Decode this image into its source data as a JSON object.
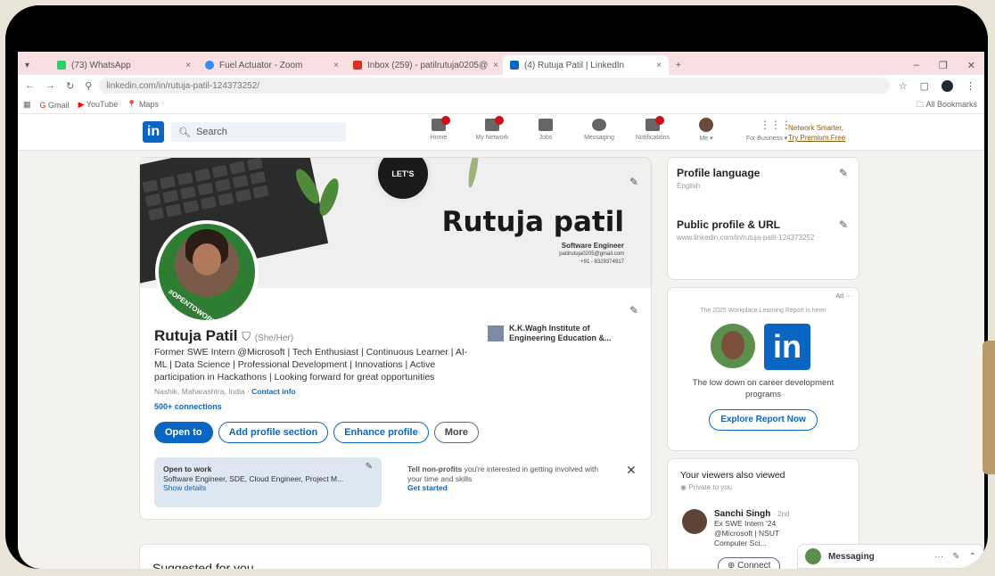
{
  "browser": {
    "tabs": [
      {
        "label": "(73) WhatsApp",
        "color": "#25d366"
      },
      {
        "label": "Fuel Actuator - Zoom",
        "color": "#2d8cff"
      },
      {
        "label": "Inbox (259) - patilrutuja0205@",
        "color": "#d93025"
      },
      {
        "label": "(4) Rutuja Patil | LinkedIn",
        "color": "#0a66c2",
        "active": true
      }
    ],
    "new_tab": "+",
    "url": "linkedin.com/in/rutuja-patil-124373252/",
    "bookmarks": [
      "Gmail",
      "YouTube",
      "Maps"
    ],
    "all_bookmarks": "All Bookmarks"
  },
  "linkedin": {
    "logo": "in",
    "search_placeholder": "Search",
    "nav": [
      {
        "label": "Home",
        "badge": true
      },
      {
        "label": "My Network",
        "badge": true
      },
      {
        "label": "Jobs",
        "badge": false
      },
      {
        "label": "Messaging",
        "badge": false
      },
      {
        "label": "Notifications",
        "badge": true
      },
      {
        "label": "Me ▾",
        "badge": false,
        "avatar": true
      },
      {
        "label": "For Business ▾",
        "badge": false
      }
    ],
    "premium": [
      "Network Smarter,",
      "Try Premium Free"
    ]
  },
  "profile": {
    "banner": {
      "cup_text": "LET'S",
      "name": "Rutuja patil",
      "title": "Software Engineer",
      "email": "patilrutuja0205@gmail.com",
      "phone": "+91 - 8329374917"
    },
    "avatar_text": "#OPENTOWORK",
    "name": "Rutuja Patil",
    "pronouns": "(She/Her)",
    "headline": "Former SWE Intern @Microsoft | Tech Enthusiast | Continuous Learner | AI-ML | Data Science | Professional Development | Innovations | Active participation in Hackathons | Looking forward for great opportunities",
    "location": "Nashik, Maharashtra, India",
    "contact_info": "Contact info",
    "connections": "500+ connections",
    "education": "K.K.Wagh Institute of Engineering Education &...",
    "buttons": {
      "open_to": "Open to",
      "add_section": "Add profile section",
      "enhance": "Enhance profile",
      "more": "More"
    },
    "open_to_work": {
      "title": "Open to work",
      "roles": "Software Engineer, SDE, Cloud Engineer, Project M...",
      "show_details": "Show details"
    },
    "nonprofits": {
      "bold": "Tell non-profits",
      "text": " you're interested in getting involved with your time and skills",
      "link": "Get started"
    },
    "suggested": "Suggested for you"
  },
  "right": {
    "profile_language": {
      "title": "Profile language",
      "value": "English"
    },
    "public_profile": {
      "title": "Public profile & URL",
      "value": "www.linkedin.com/in/rutuja-patil-124373252"
    },
    "ad": {
      "label": "Ad ···",
      "top": "The 2025 Workplace Learning Report is here!",
      "copy": "The low down on career development programs",
      "button": "Explore Report Now"
    },
    "viewers": {
      "title": "Your viewers also viewed",
      "private": "Private to you",
      "person_name": "Sanchi Singh",
      "degree": "· 2nd",
      "desc": "Ex SWE Intern '24 @Microsoft | NSUT Computer Sci...",
      "connect": "Connect"
    },
    "messaging": "Messaging"
  }
}
